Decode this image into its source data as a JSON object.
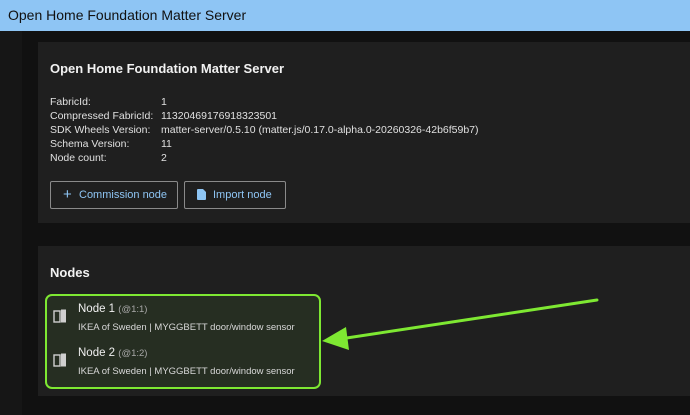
{
  "app": {
    "title": "Open Home Foundation Matter Server"
  },
  "server_card": {
    "title": "Open Home Foundation Matter Server",
    "rows": [
      {
        "label": "FabricId:",
        "value": "1"
      },
      {
        "label": "Compressed FabricId:",
        "value": "11320469176918323501"
      },
      {
        "label": "SDK Wheels Version:",
        "value": "matter-server/0.5.10 (matter.js/0.17.0-alpha.0-20260326-42b6f59b7)"
      },
      {
        "label": "Schema Version:",
        "value": "11"
      },
      {
        "label": "Node count:",
        "value": "2"
      }
    ],
    "buttons": {
      "commission": {
        "label": "Commission node",
        "icon": "plus-icon"
      },
      "import": {
        "label": "Import node",
        "icon": "document-icon"
      }
    }
  },
  "nodes_card": {
    "title": "Nodes",
    "nodes": [
      {
        "name": "Node 1",
        "address": "(@1:1)",
        "description": "IKEA of Sweden | MYGGBETT door/window sensor",
        "icon": "door-sensor-icon"
      },
      {
        "name": "Node 2",
        "address": "(@1:2)",
        "description": "IKEA of Sweden | MYGGBETT door/window sensor",
        "icon": "door-sensor-icon"
      }
    ]
  },
  "annotation": {
    "highlight_color": "#7ee832",
    "arrow_color": "#7ee832"
  },
  "colors": {
    "accent": "#8ec5f4",
    "topbar": "#8ec5f4",
    "card": "#1f1f1f",
    "background": "#111111"
  }
}
